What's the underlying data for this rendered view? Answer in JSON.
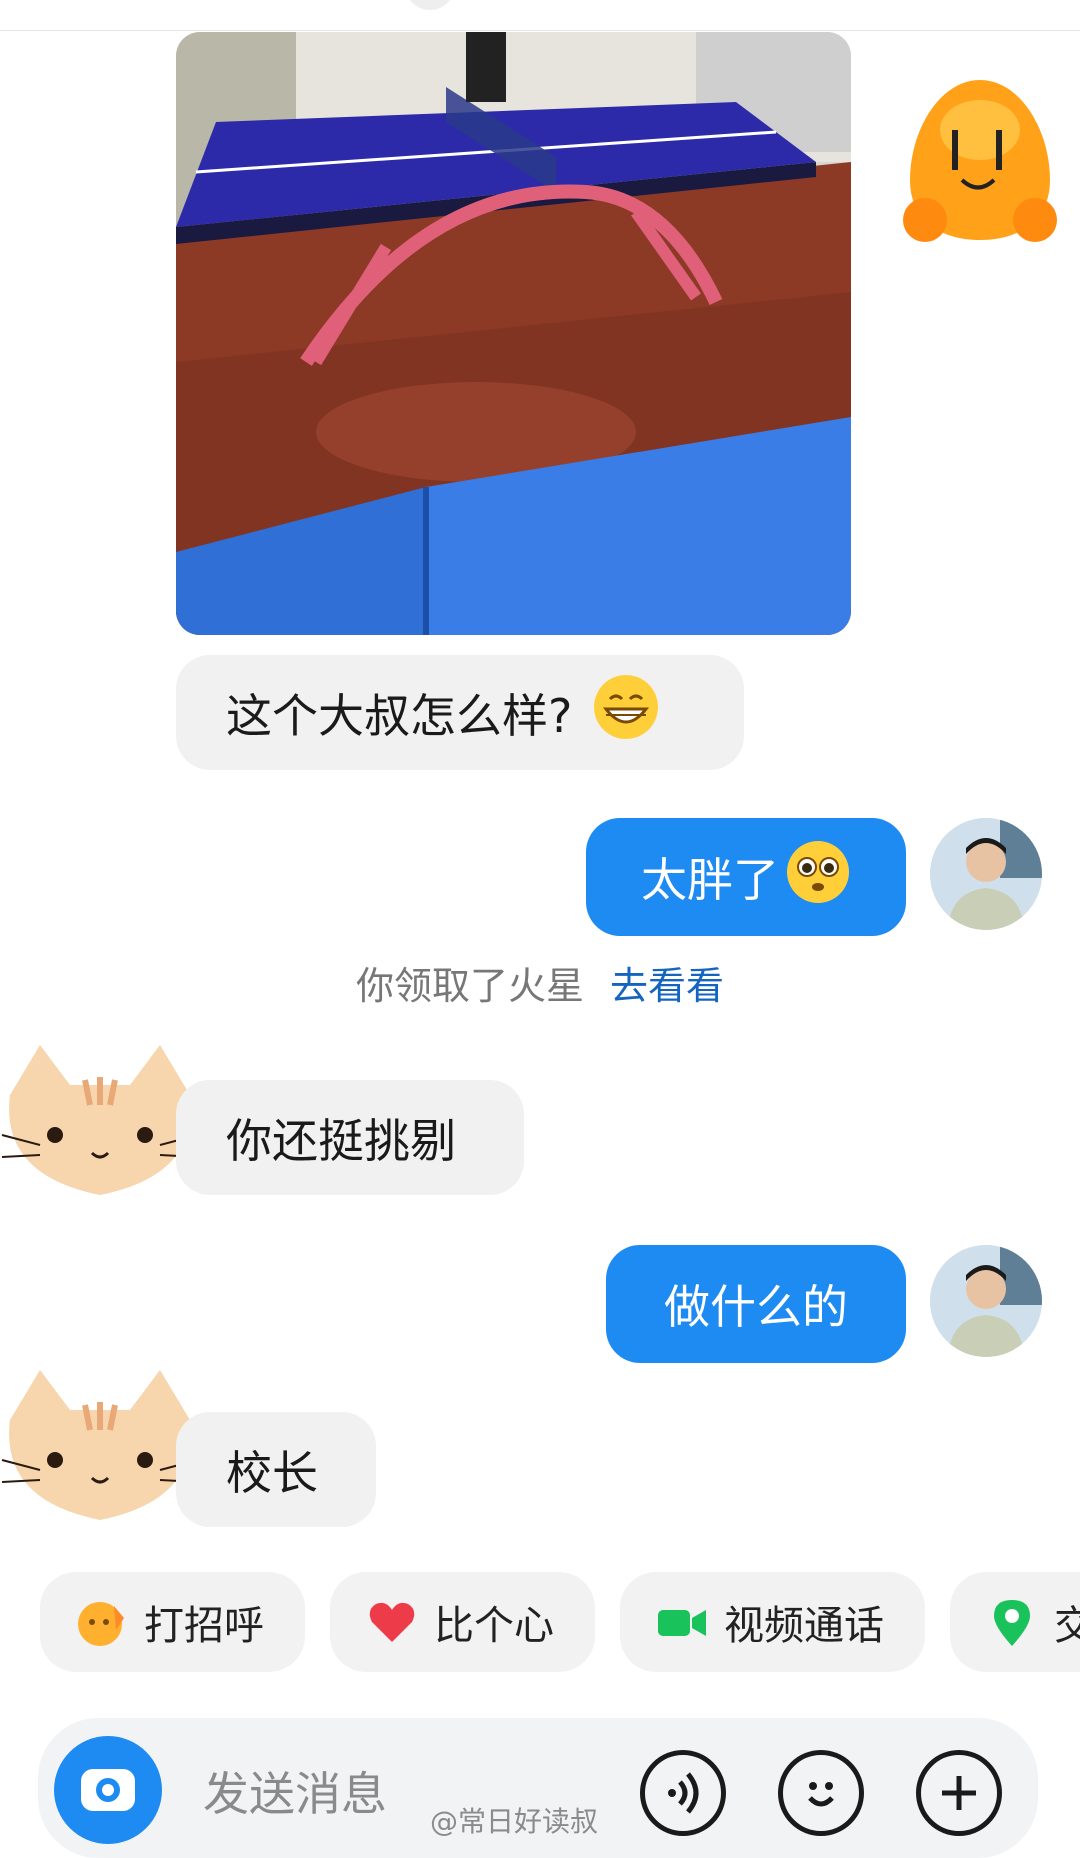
{
  "messages": {
    "m1_text": "这个大叔怎么样?",
    "m2_text": "太胖了",
    "m3_text": "你还挺挑剔",
    "m4_text": "做什么的",
    "m5_text": "校长"
  },
  "system_notice": {
    "text": "你领取了火星",
    "link": "去看看"
  },
  "quick_actions": [
    {
      "label": "打招呼",
      "icon": "wave-hand-icon"
    },
    {
      "label": "比个心",
      "icon": "heart-icon"
    },
    {
      "label": "视频通话",
      "icon": "video-camera-icon"
    },
    {
      "label": "交",
      "icon": "location-pin-icon"
    }
  ],
  "input": {
    "placeholder": "发送消息"
  },
  "watermark": "@常日好读叔",
  "colors": {
    "accent": "#1d8bf1",
    "link": "#1565c0",
    "incoming_bubble": "#f1f1f1"
  }
}
